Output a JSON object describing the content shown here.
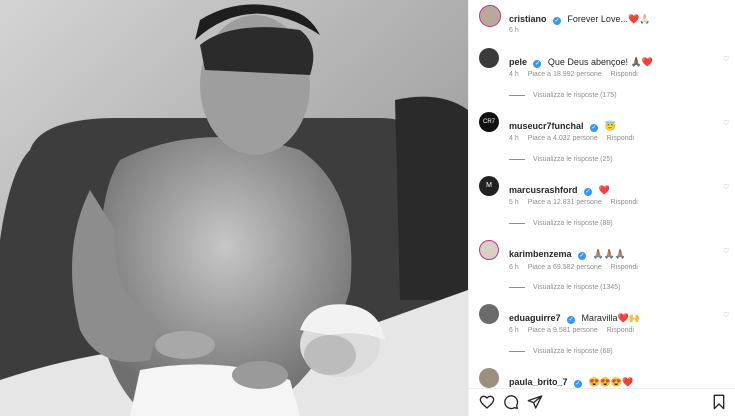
{
  "post": {
    "username": "cristiano",
    "caption": "Forever Love...❤️🙏🏻",
    "time": "6 h"
  },
  "comments": [
    {
      "username": "pele",
      "text": "Que Deus abençoe! 🙏🏾❤️",
      "time": "4 h",
      "likes": "Piace a 18.992 persone",
      "reply": "Rispondi",
      "view_replies": "Visualizza le risposte (175)"
    },
    {
      "username": "museucr7funchal",
      "text": "😇",
      "time": "4 h",
      "likes": "Piace a 4.032 persone",
      "reply": "Rispondi",
      "view_replies": "Visualizza le risposte (25)"
    },
    {
      "username": "marcusrashford",
      "text": "❤️",
      "time": "5 h",
      "likes": "Piace a 12.831 persone",
      "reply": "Rispondi",
      "view_replies": "Visualizza le risposte (88)"
    },
    {
      "username": "karimbenzema",
      "text": "🙏🏽🙏🏽🙏🏽",
      "time": "6 h",
      "likes": "Piace a 69.582 persone",
      "reply": "Rispondi",
      "view_replies": "Visualizza le risposte (1345)"
    },
    {
      "username": "eduaguirre7",
      "text": "Maravilla❤️🙌",
      "time": "6 h",
      "likes": "Piace a 9.581 persone",
      "reply": "Rispondi",
      "view_replies": "Visualizza le risposte (68)"
    },
    {
      "username": "paula_brito_7",
      "text": "😍😍😍❤️",
      "time": "",
      "likes": "",
      "reply": "",
      "view_replies": ""
    }
  ],
  "icons": [
    "heart-icon",
    "comment-icon",
    "share-icon",
    "bookmark-icon",
    "verified-icon"
  ],
  "colors": {
    "verified": "#3897f0",
    "muted": "#8e8e8e",
    "text": "#262626"
  }
}
